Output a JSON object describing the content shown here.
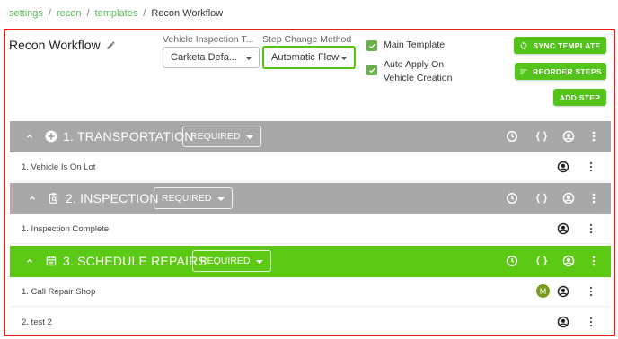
{
  "breadcrumb": {
    "items": [
      "settings",
      "recon",
      "templates"
    ],
    "separator": "/",
    "current": "Recon Workflow"
  },
  "header": {
    "title": "Recon Workflow",
    "vehicle_inspection_label": "Vehicle Inspection T...",
    "vehicle_inspection_value": "Carketa Defa...",
    "step_change_label": "Step Change Method",
    "step_change_value": "Automatic Flow",
    "main_template_label": "Main Template",
    "main_template_checked": true,
    "auto_apply_label_line1": "Auto Apply On",
    "auto_apply_label_line2": "Vehicle Creation",
    "auto_apply_checked": true,
    "sync_button": "SYNC TEMPLATE",
    "reorder_button": "REORDER STEPS",
    "add_step_button": "ADD STEP"
  },
  "colors": {
    "accent_green": "#52c41a",
    "gray_header": "#a8a8a8",
    "active_step": "#5cc915",
    "border_red": "#e02020"
  },
  "steps": [
    {
      "title": "1. TRANSPORTATION",
      "requirement": "REQUIRED",
      "icon": "plus-circle-icon",
      "color": "#a8a8a8",
      "tasks": [
        {
          "label": "1. Vehicle Is On Lot",
          "assignee_initial": ""
        }
      ]
    },
    {
      "title": "2. INSPECTION",
      "requirement": "REQUIRED",
      "icon": "clipboard-search-icon",
      "color": "#a8a8a8",
      "tasks": [
        {
          "label": "1. Inspection Complete",
          "assignee_initial": ""
        }
      ]
    },
    {
      "title": "3. SCHEDULE REPAIRS",
      "requirement": "REQUIRED",
      "icon": "calendar-icon",
      "color": "#5cc915",
      "tasks": [
        {
          "label": "1. Call Repair Shop",
          "assignee_initial": "M"
        },
        {
          "label": "2. test 2",
          "assignee_initial": ""
        }
      ]
    }
  ]
}
